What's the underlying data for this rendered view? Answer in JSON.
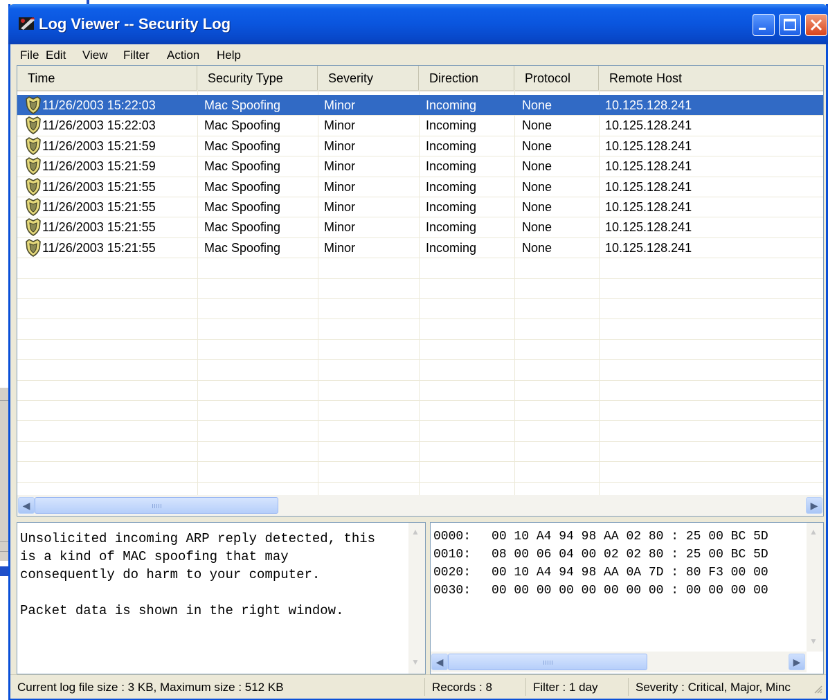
{
  "window": {
    "title": "Log Viewer -- Security Log",
    "title_bar_color": "#0a55de"
  },
  "menu": [
    "File",
    "Edit",
    "View",
    "Filter",
    "Action",
    "Help"
  ],
  "columns": [
    "Time",
    "Security Type",
    "Severity",
    "Direction",
    "Protocol",
    "Remote Host"
  ],
  "rows": [
    {
      "time": "11/26/2003 15:22:03",
      "type": "Mac Spoofing",
      "severity": "Minor",
      "direction": "Incoming",
      "protocol": "None",
      "host": "10.125.128.241",
      "selected": true
    },
    {
      "time": "11/26/2003 15:22:03",
      "type": "Mac Spoofing",
      "severity": "Minor",
      "direction": "Incoming",
      "protocol": "None",
      "host": "10.125.128.241"
    },
    {
      "time": "11/26/2003 15:21:59",
      "type": "Mac Spoofing",
      "severity": "Minor",
      "direction": "Incoming",
      "protocol": "None",
      "host": "10.125.128.241"
    },
    {
      "time": "11/26/2003 15:21:59",
      "type": "Mac Spoofing",
      "severity": "Minor",
      "direction": "Incoming",
      "protocol": "None",
      "host": "10.125.128.241"
    },
    {
      "time": "11/26/2003 15:21:55",
      "type": "Mac Spoofing",
      "severity": "Minor",
      "direction": "Incoming",
      "protocol": "None",
      "host": "10.125.128.241"
    },
    {
      "time": "11/26/2003 15:21:55",
      "type": "Mac Spoofing",
      "severity": "Minor",
      "direction": "Incoming",
      "protocol": "None",
      "host": "10.125.128.241"
    },
    {
      "time": "11/26/2003 15:21:55",
      "type": "Mac Spoofing",
      "severity": "Minor",
      "direction": "Incoming",
      "protocol": "None",
      "host": "10.125.128.241"
    },
    {
      "time": "11/26/2003 15:21:55",
      "type": "Mac Spoofing",
      "severity": "Minor",
      "direction": "Incoming",
      "protocol": "None",
      "host": "10.125.128.241"
    }
  ],
  "row_icon": "shield-icon",
  "selection_color": "#316ac5",
  "description": "Unsolicited incoming ARP reply detected, this\nis a kind of MAC spoofing that may\nconsequently do harm to your computer.\n\nPacket data is shown in the right window.",
  "packet_data": [
    {
      "offset": "0000:",
      "bytes": "00 10 A4 94 98 AA 02 80 : 25 00 BC 5D"
    },
    {
      "offset": "0010:",
      "bytes": "08 00 06 04 00 02 02 80 : 25 00 BC 5D"
    },
    {
      "offset": "0020:",
      "bytes": "00 10 A4 94 98 AA 0A 7D : 80 F3 00 00"
    },
    {
      "offset": "0030:",
      "bytes": "00 00 00 00 00 00 00 00 : 00 00 00 00"
    }
  ],
  "status": {
    "log_size": "Current log file size : 3 KB, Maximum size : 512 KB",
    "records": "Records : 8",
    "filter": "Filter : 1 day",
    "severity": "Severity : Critical, Major, Minc"
  }
}
